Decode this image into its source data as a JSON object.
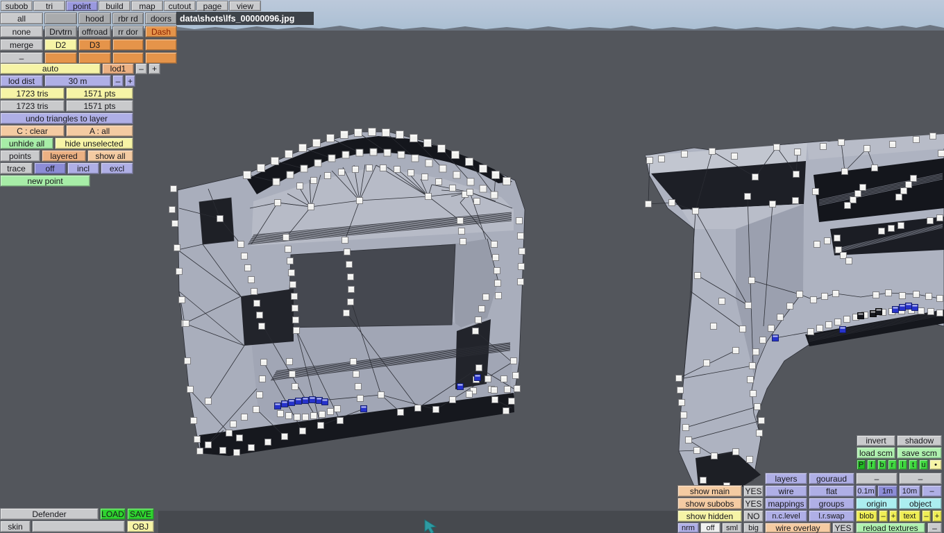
{
  "colors": {
    "sky_top": "#bcc9db",
    "sky_bottom": "#aabfd3",
    "viewport": "#53565c",
    "panel_purple": "#afafe6",
    "panel_orange": "#e5944a",
    "panel_peach": "#f4cba2",
    "panel_yellow": "#f6f4a6",
    "bright_green": "#2fd42f",
    "cyan": "#abeef0",
    "selected_vertex_blue": "#2733cb",
    "vertex_white": "#f1f1ef"
  },
  "menu": [
    "subob",
    "tri",
    "point",
    "build",
    "map",
    "cutout",
    "page",
    "view"
  ],
  "title_bar": {
    "path": "data\\shots\\lfs_00000096.jpg"
  },
  "subobj": {
    "all": "all",
    "hood": "hood",
    "rbr_rd": "rbr rd",
    "doors": "doors",
    "none": "none",
    "drvtrn": "Drvtrn",
    "offroad": "offroad",
    "rr_dor": "rr dor",
    "dash": "Dash",
    "merge": "merge",
    "d2": "D2",
    "d3": "D3",
    "dash_btn": "–"
  },
  "lod": {
    "auto": "auto",
    "lod1": "lod1",
    "minus": "–",
    "plus": "+",
    "lod_dist": "lod dist",
    "value": "30 m",
    "dist_minus": "–",
    "dist_plus": "+"
  },
  "stats": {
    "tris_current": "1723 tris",
    "pts_current": "1571 pts",
    "tris_total": "1723 tris",
    "pts_total": "1571 pts"
  },
  "tools": {
    "undo": "undo triangles to layer",
    "c_clear": "C : clear",
    "a_all": "A : all",
    "unhide_all": "unhide all",
    "hide_unselected": "hide unselected",
    "points": "points",
    "layered": "layered",
    "show_all": "show all",
    "trace": "trace",
    "trace_off": "off",
    "trace_incl": "incl",
    "trace_excl": "excl",
    "new_point": "new point"
  },
  "vehicle": {
    "name": "Defender",
    "load": "LOAD",
    "save": "SAVE",
    "skin": "skin",
    "obj": "OBJ"
  },
  "scm": {
    "invert": "invert",
    "shadow": "shadow",
    "load_scm": "load scm",
    "save_scm": "save scm",
    "views": [
      "P",
      "f",
      "b",
      "r",
      "l",
      "t",
      "u",
      "•"
    ]
  },
  "display": {
    "layers": "layers",
    "gouraud": "gouraud",
    "dash_a": "–",
    "dash_b": "–",
    "wire": "wire",
    "flat": "flat",
    "m_01": "0.1m",
    "m_1": "1m",
    "m_10": "10m",
    "m_dash": "–",
    "mappings": "mappings",
    "groups": "groups",
    "origin": "origin",
    "object": "object",
    "nc_level": "n.c.level",
    "lr_swap": "l.r.swap",
    "blob": "blob",
    "blob_minus": "–",
    "blob_plus": "+",
    "text": "text",
    "text_minus": "–",
    "text_plus": "+",
    "show_main": "show main",
    "show_main_val": "YES",
    "show_subobs": "show subobs",
    "show_subobs_val": "YES",
    "show_hidden": "show hidden",
    "show_hidden_val": "NO",
    "nrm": "nrm",
    "nrm_off": "off",
    "nrm_sml": "sml",
    "nrm_big": "big",
    "wire_overlay": "wire overlay",
    "wire_overlay_val": "YES",
    "reload_textures": "reload textures",
    "reload_dash": "–"
  }
}
